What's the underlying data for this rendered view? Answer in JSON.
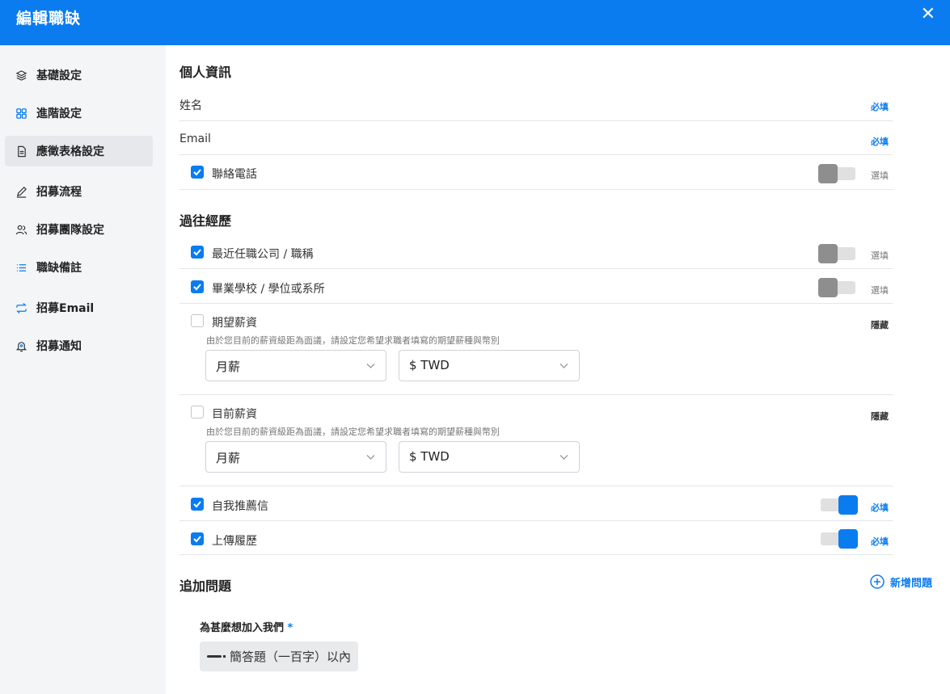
{
  "header": {
    "title": "編輯職缺",
    "close_label": "✕"
  },
  "sidebar": {
    "items": [
      {
        "label": "基礎設定",
        "icon": "layers-icon"
      },
      {
        "label": "進階設定",
        "icon": "grid-icon"
      },
      {
        "label": "應徵表格設定",
        "icon": "document-icon",
        "active": true
      },
      {
        "label": "招募流程",
        "icon": "pencil-icon"
      },
      {
        "label": "招募團隊設定",
        "icon": "users-icon"
      },
      {
        "label": "職缺備註",
        "icon": "list-icon"
      },
      {
        "label": "招募Email",
        "icon": "repeat-icon"
      },
      {
        "label": "招募通知",
        "icon": "bell-icon"
      }
    ]
  },
  "personal": {
    "title": "個人資訊",
    "name_label": "姓名",
    "name_status": "必填",
    "email_label": "Email",
    "email_status": "必填",
    "phone_label": "聯絡電話",
    "phone_status": "選填"
  },
  "experience": {
    "title": "過往經歷",
    "recent_company_label": "最近任職公司 / 職稱",
    "recent_company_status": "選填",
    "school_label": "畢業學校 / 學位或系所",
    "school_status": "選填",
    "expected_salary": {
      "label": "期望薪資",
      "status": "隱藏",
      "hint": "由於您目前的薪資級距為面議，請設定您希望求職者填寫的期望薪種與幣別",
      "period": "月薪",
      "currency": "$ TWD"
    },
    "current_salary": {
      "label": "目前薪資",
      "status": "隱藏",
      "hint": "由於您目前的薪資級距為面議，請設定您希望求職者填寫的期望薪種與幣別",
      "period": "月薪",
      "currency": "$ TWD"
    },
    "cover_letter_label": "自我推薦信",
    "cover_letter_status": "必填",
    "resume_label": "上傳履歷",
    "resume_status": "必填"
  },
  "extra": {
    "title": "追加問題",
    "add_label": "新增問題",
    "question_title": "為甚麼想加入我們",
    "question_required_mark": "*",
    "question_type": "簡答題（一百字）以內"
  },
  "colors": {
    "accent": "#0a7cf0",
    "sidebar_bg": "#f4f5f7"
  }
}
